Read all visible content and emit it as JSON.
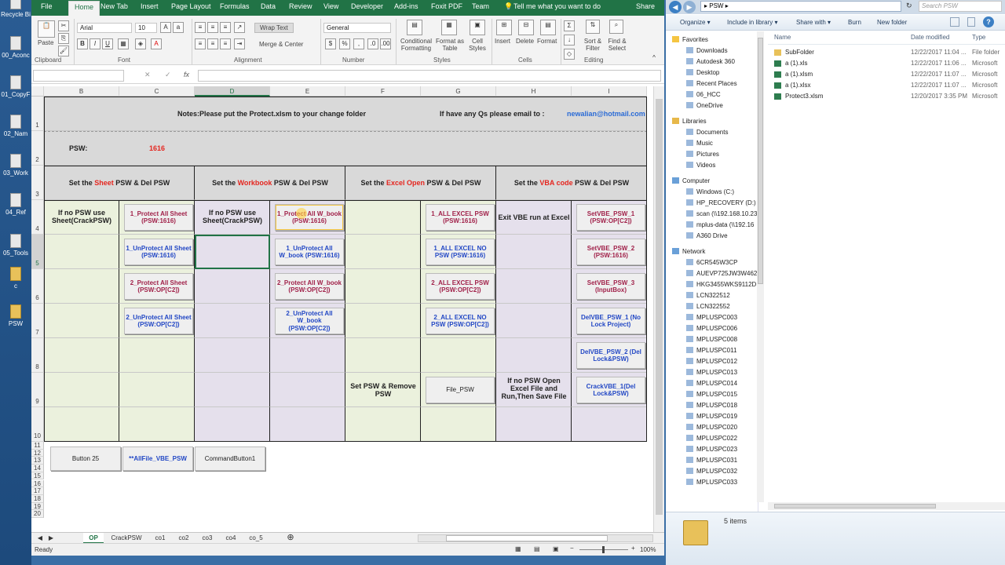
{
  "desktop": {
    "items": [
      {
        "label": "Recycle Bi"
      },
      {
        "label": "00_Aconc"
      },
      {
        "label": "01_CopyF"
      },
      {
        "label": "02_Nam"
      },
      {
        "label": "03_Work"
      },
      {
        "label": "04_Ref"
      },
      {
        "label": "05_Tools"
      },
      {
        "label": "c"
      },
      {
        "label": "PSW"
      }
    ]
  },
  "excel": {
    "ribbon_tabs": [
      "File",
      "Home",
      "New Tab",
      "Insert",
      "Page Layout",
      "Formulas",
      "Data",
      "Review",
      "View",
      "Developer",
      "Add-ins",
      "Foxit PDF",
      "Team"
    ],
    "tell_me": "Tell me what you want to do",
    "share": "Share",
    "paste": "Paste",
    "font_name": "Arial",
    "font_size": "10",
    "wrap_text": "Wrap Text",
    "merge_center": "Merge & Center",
    "number_format": "General",
    "conditional_formatting": "Conditional Formatting",
    "format_as_table": "Format as Table",
    "cell_styles": "Cell Styles",
    "insert": "Insert",
    "delete": "Delete",
    "format": "Format",
    "sort_filter": "Sort & Filter",
    "find_select": "Find & Select",
    "groups": [
      "Clipboard",
      "Font",
      "Alignment",
      "Number",
      "Styles",
      "Cells",
      "Editing"
    ],
    "fx": "fx",
    "columns": [
      "B",
      "C",
      "D",
      "E",
      "F",
      "G",
      "H",
      "I"
    ],
    "rows": [
      "1",
      "2",
      "3",
      "4",
      "5",
      "6",
      "7",
      "8",
      "9",
      "10",
      "11",
      "12",
      "13",
      "14",
      "15",
      "16",
      "17",
      "18",
      "19",
      "20"
    ],
    "sheet": {
      "notes": "Notes:Please put the Protect.xlsm to your change folder",
      "email_prefix": "If have any Qs please email to :",
      "email": "newalian@hotmail.com",
      "psw_label": "PSW:",
      "psw_value": "1616",
      "sections": [
        {
          "pre": "Set the ",
          "hl": "Sheet",
          "post": " PSW & Del PSW"
        },
        {
          "pre": "Set the ",
          "hl": "Workbook",
          "post": " PSW & Del PSW"
        },
        {
          "pre": "Set the ",
          "hl": "Excel Open",
          "post": " PSW & Del PSW"
        },
        {
          "pre": "Set the ",
          "hl": "VBA code",
          "post": " PSW & Del PSW"
        }
      ],
      "no_psw_sheet": "If no PSW use Sheet(CrackPSW)",
      "no_psw_wb": "If no PSW use Sheet(CrackPSW)",
      "exit_vbe": "Exit VBE run at Excel",
      "set_psw_remove": "Set PSW & Remove PSW",
      "no_psw_open": "If no PSW Open Excel File and Run,Then Save File",
      "btns_c": [
        "1_Protect All Sheet (PSW:1616)",
        "1_UnProtect All Sheet (PSW:1616)",
        "2_Protect All Sheet (PSW:OP[C2])",
        "2_UnProtect All Sheet (PSW:OP[C2])"
      ],
      "btns_e": [
        "1_Protect All W_book (PSW:1616)",
        "1_UnProtect All W_book (PSW:1616)",
        "2_Protect All W_book (PSW:OP[C2])",
        "2_UnProtect All W_book (PSW:OP[C2])"
      ],
      "btns_g": [
        "1_ALL EXCEL PSW (PSW:1616)",
        "1_ALL EXCEL NO PSW (PSW:1616)",
        "2_ALL EXCEL PSW (PSW:OP[C2])",
        "2_ALL EXCEL NO PSW (PSW:OP[C2])",
        "File_PSW"
      ],
      "btns_i": [
        "SetVBE_PSW_1 (PSW:OP[C2])",
        "SetVBE_PSW_2 (PSW:1616)",
        "SetVBE_PSW_3 (InputBox)",
        "DelVBE_PSW_1 (No Lock Project)",
        "DelVBE_PSW_2 (Del Lock&PSW)",
        "CrackVBE_1(Del Lock&PSW)"
      ],
      "bottom_btns": [
        "Button 25",
        "**AllFile_VBE_PSW",
        "CommandButton1"
      ]
    },
    "sheet_tabs": [
      "OP",
      "CrackPSW",
      "co1",
      "co2",
      "co3",
      "co4",
      "co_5"
    ],
    "status": "Ready",
    "zoom": "100%"
  },
  "explorer": {
    "path": "PSW",
    "search_placeholder": "Search PSW",
    "toolbar": [
      "Organize ▾",
      "Include in library ▾",
      "Share with ▾",
      "Burn",
      "New folder"
    ],
    "nav": [
      {
        "label": "Favorites",
        "head": true
      },
      {
        "label": "Downloads"
      },
      {
        "label": "Autodesk 360"
      },
      {
        "label": "Desktop"
      },
      {
        "label": "Recent Places"
      },
      {
        "label": "06_HCC"
      },
      {
        "label": "OneDrive"
      },
      {
        "label": "Libraries",
        "head": true
      },
      {
        "label": "Documents"
      },
      {
        "label": "Music"
      },
      {
        "label": "Pictures"
      },
      {
        "label": "Videos"
      },
      {
        "label": "Computer",
        "head": true
      },
      {
        "label": "Windows (C:)"
      },
      {
        "label": "HP_RECOVERY (D:)"
      },
      {
        "label": "scan (\\\\192.168.10.23"
      },
      {
        "label": "mplus-data (\\\\192.16"
      },
      {
        "label": "A360 Drive"
      },
      {
        "label": "Network",
        "head": true
      },
      {
        "label": "6CR545W3CP"
      },
      {
        "label": "AUEVP725JW3W462"
      },
      {
        "label": "HKG3455WKS9112D"
      },
      {
        "label": "LCN322512"
      },
      {
        "label": "LCN322552"
      },
      {
        "label": "MPLUSPC003"
      },
      {
        "label": "MPLUSPC006"
      },
      {
        "label": "MPLUSPC008"
      },
      {
        "label": "MPLUSPC011"
      },
      {
        "label": "MPLUSPC012"
      },
      {
        "label": "MPLUSPC013"
      },
      {
        "label": "MPLUSPC014"
      },
      {
        "label": "MPLUSPC015"
      },
      {
        "label": "MPLUSPC018"
      },
      {
        "label": "MPLUSPC019"
      },
      {
        "label": "MPLUSPC020"
      },
      {
        "label": "MPLUSPC022"
      },
      {
        "label": "MPLUSPC023"
      },
      {
        "label": "MPLUSPC031"
      },
      {
        "label": "MPLUSPC032"
      },
      {
        "label": "MPLUSPC033"
      }
    ],
    "columns": [
      "Name",
      "Date modified",
      "Type"
    ],
    "files": [
      {
        "name": "SubFolder",
        "date": "12/22/2017 11:04 ...",
        "type": "File folder"
      },
      {
        "name": "a (1).xls",
        "date": "12/22/2017 11:06 ...",
        "type": "Microsoft"
      },
      {
        "name": "a (1).xlsm",
        "date": "12/22/2017 11:07 ...",
        "type": "Microsoft"
      },
      {
        "name": "a (1).xlsx",
        "date": "12/22/2017 11:07 ...",
        "type": "Microsoft"
      },
      {
        "name": "Protect3.xlsm",
        "date": "12/20/2017 3:35 PM",
        "type": "Microsoft"
      }
    ],
    "item_count": "5 items"
  },
  "colors": {
    "excel_green": "#217346",
    "sheet_gray": "#d9d9d9",
    "green_fill": "#ebf1dd",
    "lavender_fill": "#e5e0ec",
    "red_text": "#e5261f",
    "maroon_text": "#a1224a",
    "blue_text": "#2348c5"
  }
}
